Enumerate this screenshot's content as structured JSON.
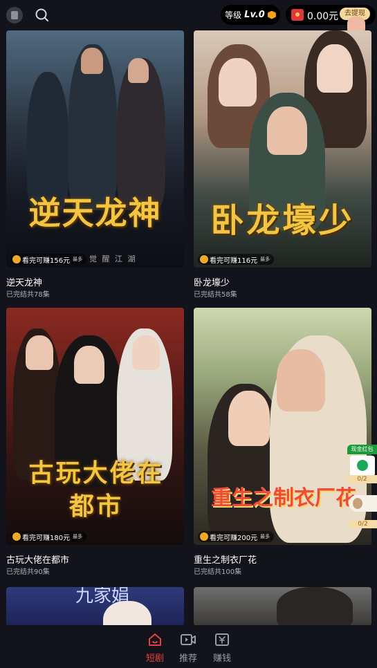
{
  "topbar": {
    "level_label": "等级",
    "level_value": "Lv.0",
    "balance": "0.00元",
    "withdraw_label": "去提现"
  },
  "dramas": [
    {
      "art_text": "逆天龙神",
      "art_sub": "觉 醒 江 湖",
      "earn": "看完可赚156元",
      "earn_suffix": "最多",
      "name": "逆天龙神",
      "episodes": "已完结共78集"
    },
    {
      "art_text": "卧龙壕少",
      "art_sub": "",
      "earn": "看完可赚116元",
      "earn_suffix": "最多",
      "name": "卧龙壕少",
      "episodes": "已完结共58集"
    },
    {
      "art_text": "古玩大佬在都市",
      "art_sub": "",
      "earn": "看完可赚180元",
      "earn_suffix": "最多",
      "name": "古玩大佬在都市",
      "episodes": "已完结共90集"
    },
    {
      "art_text": "重生之制衣厂花",
      "art_sub": "",
      "earn": "看完可赚200元",
      "earn_suffix": "最多",
      "name": "重生之制衣厂花",
      "episodes": "已完结共100集"
    },
    {
      "art_text": "九家娟",
      "art_sub": "",
      "earn": "",
      "earn_suffix": "",
      "name": "",
      "episodes": ""
    }
  ],
  "floating": {
    "cash_tag": "现金红包",
    "cash_count": "0/2",
    "rocket_count": "0/2"
  },
  "bottom_nav": [
    {
      "label": "短剧",
      "icon": "home-icon",
      "active": true
    },
    {
      "label": "推荐",
      "icon": "video-icon",
      "active": false
    },
    {
      "label": "赚钱",
      "icon": "money-icon",
      "active": false
    }
  ],
  "colors": {
    "background": "#12131b",
    "accent": "#e8413f",
    "gold": "#f2c543"
  }
}
